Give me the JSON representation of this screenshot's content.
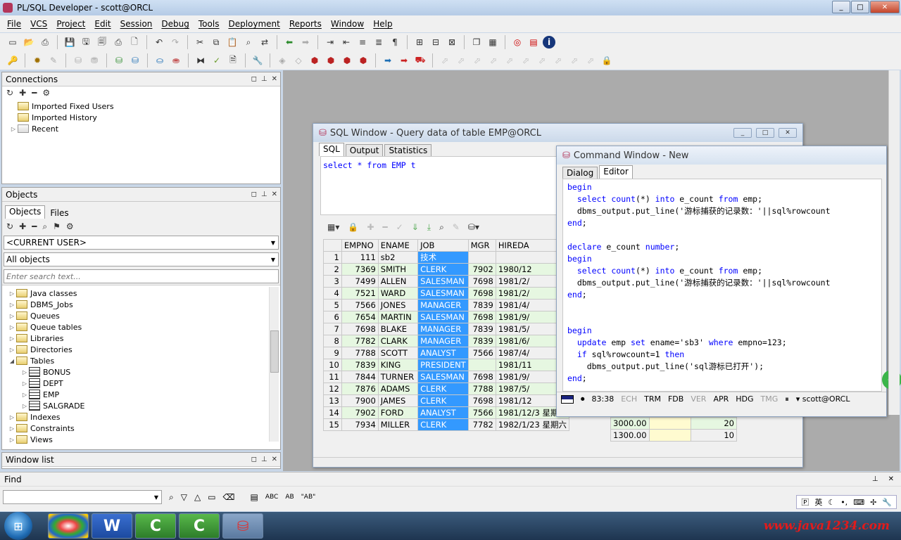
{
  "app": {
    "title": "PL/SQL Developer - scott@ORCL",
    "window_buttons": [
      "_",
      "□",
      "✕"
    ]
  },
  "menu": [
    "File",
    "VCS",
    "Project",
    "Edit",
    "Session",
    "Debug",
    "Tools",
    "Deployment",
    "Reports",
    "Window",
    "Help"
  ],
  "connections": {
    "title": "Connections",
    "items": [
      "Imported Fixed Users",
      "Imported History",
      "Recent"
    ]
  },
  "objects": {
    "title": "Objects",
    "tabs": [
      "Objects",
      "Files"
    ],
    "user_combo": "<CURRENT USER>",
    "filter_combo": "All objects",
    "search_placeholder": "Enter search text...",
    "tree": [
      "Java classes",
      "DBMS_Jobs",
      "Queues",
      "Queue tables",
      "Libraries",
      "Directories",
      "Tables"
    ],
    "tables": [
      "BONUS",
      "DEPT",
      "EMP",
      "SALGRADE"
    ],
    "tree_after": [
      "Indexes",
      "Constraints",
      "Views"
    ]
  },
  "window_list": {
    "title": "Window list"
  },
  "find": {
    "title": "Find",
    "labels": [
      "ABC",
      "AB",
      "\"AB\""
    ]
  },
  "sql_window": {
    "title": "SQL Window - Query data of table EMP@ORCL",
    "tabs": [
      "SQL",
      "Output",
      "Statistics"
    ],
    "query_parts": [
      "select",
      " * ",
      "from",
      " EMP t"
    ],
    "columns": [
      "EMPNO",
      "ENAME",
      "JOB",
      "MGR",
      "HIREDA"
    ],
    "rows": [
      {
        "no": "1",
        "empno": "111",
        "ename": "sb2",
        "job": "技术",
        "mgr": "",
        "hire": ""
      },
      {
        "no": "2",
        "empno": "7369",
        "ename": "SMITH",
        "job": "CLERK",
        "mgr": "7902",
        "hire": "1980/12"
      },
      {
        "no": "3",
        "empno": "7499",
        "ename": "ALLEN",
        "job": "SALESMAN",
        "mgr": "7698",
        "hire": "1981/2/"
      },
      {
        "no": "4",
        "empno": "7521",
        "ename": "WARD",
        "job": "SALESMAN",
        "mgr": "7698",
        "hire": "1981/2/"
      },
      {
        "no": "5",
        "empno": "7566",
        "ename": "JONES",
        "job": "MANAGER",
        "mgr": "7839",
        "hire": "1981/4/"
      },
      {
        "no": "6",
        "empno": "7654",
        "ename": "MARTIN",
        "job": "SALESMAN",
        "mgr": "7698",
        "hire": "1981/9/"
      },
      {
        "no": "7",
        "empno": "7698",
        "ename": "BLAKE",
        "job": "MANAGER",
        "mgr": "7839",
        "hire": "1981/5/"
      },
      {
        "no": "8",
        "empno": "7782",
        "ename": "CLARK",
        "job": "MANAGER",
        "mgr": "7839",
        "hire": "1981/6/"
      },
      {
        "no": "9",
        "empno": "7788",
        "ename": "SCOTT",
        "job": "ANALYST",
        "mgr": "7566",
        "hire": "1987/4/"
      },
      {
        "no": "10",
        "empno": "7839",
        "ename": "KING",
        "job": "PRESIDENT",
        "mgr": "",
        "hire": "1981/11"
      },
      {
        "no": "11",
        "empno": "7844",
        "ename": "TURNER",
        "job": "SALESMAN",
        "mgr": "7698",
        "hire": "1981/9/"
      },
      {
        "no": "12",
        "empno": "7876",
        "ename": "ADAMS",
        "job": "CLERK",
        "mgr": "7788",
        "hire": "1987/5/"
      },
      {
        "no": "13",
        "empno": "7900",
        "ename": "JAMES",
        "job": "CLERK",
        "mgr": "7698",
        "hire": "1981/12"
      },
      {
        "no": "14",
        "empno": "7902",
        "ename": "FORD",
        "job": "ANALYST",
        "mgr": "7566",
        "hire": "1981/12/3 星期四"
      },
      {
        "no": "15",
        "empno": "7934",
        "ename": "MILLER",
        "job": "CLERK",
        "mgr": "7782",
        "hire": "1982/1/23 星期六"
      }
    ],
    "row14_sal": "3000.00",
    "row14_deptno": "20",
    "row15_sal": "1300.00",
    "row15_deptno": "10"
  },
  "command_window": {
    "title": "Command Window - New",
    "tabs": [
      "Dialog",
      "Editor"
    ],
    "lines": [
      "begin",
      "  select count(*) into e_count from emp;",
      "  dbms_output.put_line('游标捕获的记录数：'||sql%rowcount",
      "end;",
      "",
      "declare e_count number;",
      "begin",
      "  select count(*) into e_count from emp;",
      "  dbms_output.put_line('游标捕获的记录数：'||sql%rowcount",
      "end;",
      "",
      "",
      "begin",
      "  update emp set ename='sb3' where empno=123;",
      "  if sql%rowcount=1 then",
      "    dbms_output.put_line('sql游标已打开');",
      "end;"
    ],
    "status": {
      "position": "83:38",
      "flags": [
        "ECH",
        "TRM",
        "FDB",
        "VER",
        "APR",
        "HDG",
        "TMG"
      ],
      "flags_active": [
        false,
        true,
        true,
        false,
        true,
        true,
        false
      ],
      "connection": "scott@ORCL"
    }
  },
  "taskbar": {
    "apps": [
      "W",
      "C",
      "C"
    ],
    "tray_lang": "英",
    "watermark": "www.java1234.com"
  },
  "colors": {
    "job_highlight": "#3399ff",
    "grid_row_green": "#e6f7e1",
    "keyword": "#0000ff"
  }
}
